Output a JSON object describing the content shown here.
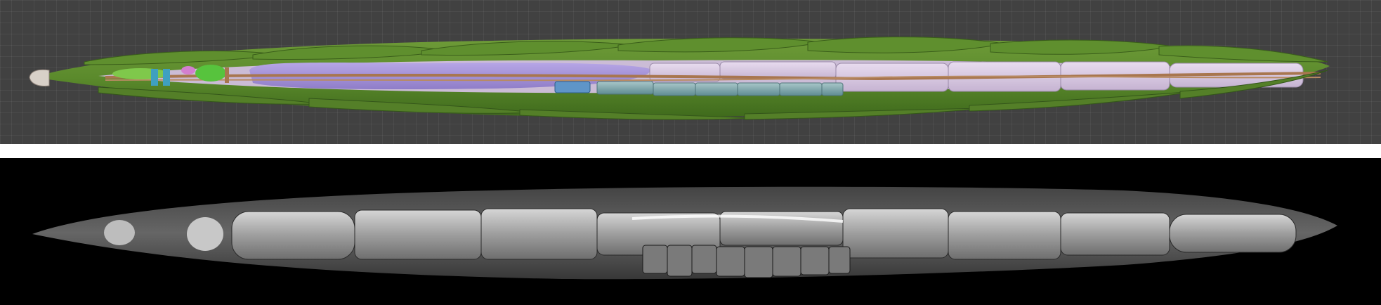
{
  "figure": {
    "panels": [
      {
        "id": "render-3d",
        "kind": "3D color model of elongated worm body on grid viewport"
      },
      {
        "id": "micrograph",
        "kind": "grayscale microscopy image of same body"
      }
    ]
  },
  "colors": {
    "viewport_bg": "#414141",
    "cuticle_green": "#5b8a2c",
    "cuticle_green_dark": "#3f6a1c",
    "pharynx_purple": "#a593d8",
    "intestine_lavender": "#d8c9e0",
    "gonad_teal": "#7da3a8",
    "nerve_tan": "#a8764f",
    "head_cap": "#d8d0c8",
    "micrograph_bg": "#000000",
    "micrograph_gray": "#bdbdbd"
  }
}
